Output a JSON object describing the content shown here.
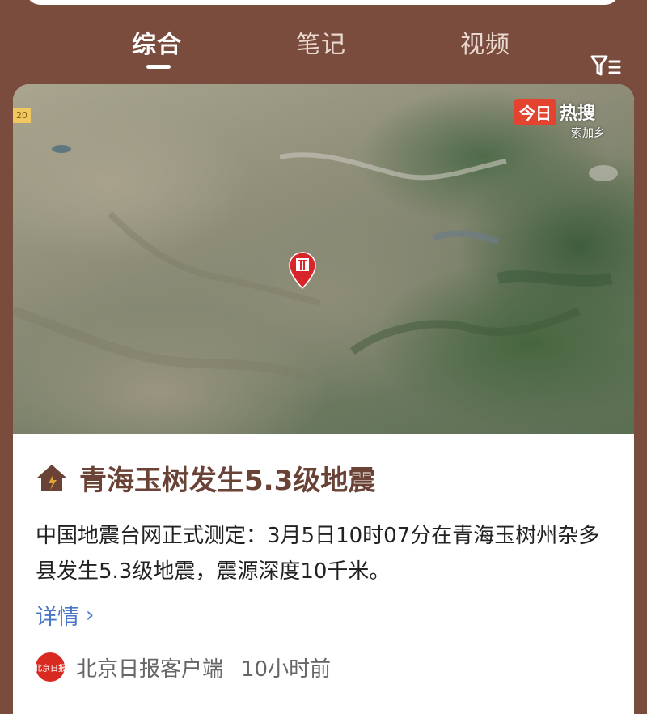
{
  "tabs": [
    {
      "label": "综合",
      "active": true
    },
    {
      "label": "笔记",
      "active": false
    },
    {
      "label": "视频",
      "active": false
    }
  ],
  "icons": {
    "filter": "filter-icon",
    "map_pin": "map-pin-icon",
    "title": "house-icon"
  },
  "map": {
    "badge_brand": "今日",
    "badge_word": "热搜",
    "badge_sub": "索加乡",
    "corner_label": "20"
  },
  "article": {
    "title": "青海玉树发生5.3级地震",
    "description": "中国地震台网正式测定：3月5日10时07分在青海玉树州杂多县发生5.3级地震，震源深度10千米。",
    "detail_label": "详情",
    "detail_chevron": "›",
    "source_name": "北京日报客户端",
    "source_time": "10小时前",
    "source_logo_text": "北京日报"
  },
  "colors": {
    "header_bg": "#7a4c3e",
    "title_color": "#6b4336",
    "link_color": "#4a78c8",
    "badge_red": "#e4432f",
    "pin_red": "#d8252a"
  }
}
